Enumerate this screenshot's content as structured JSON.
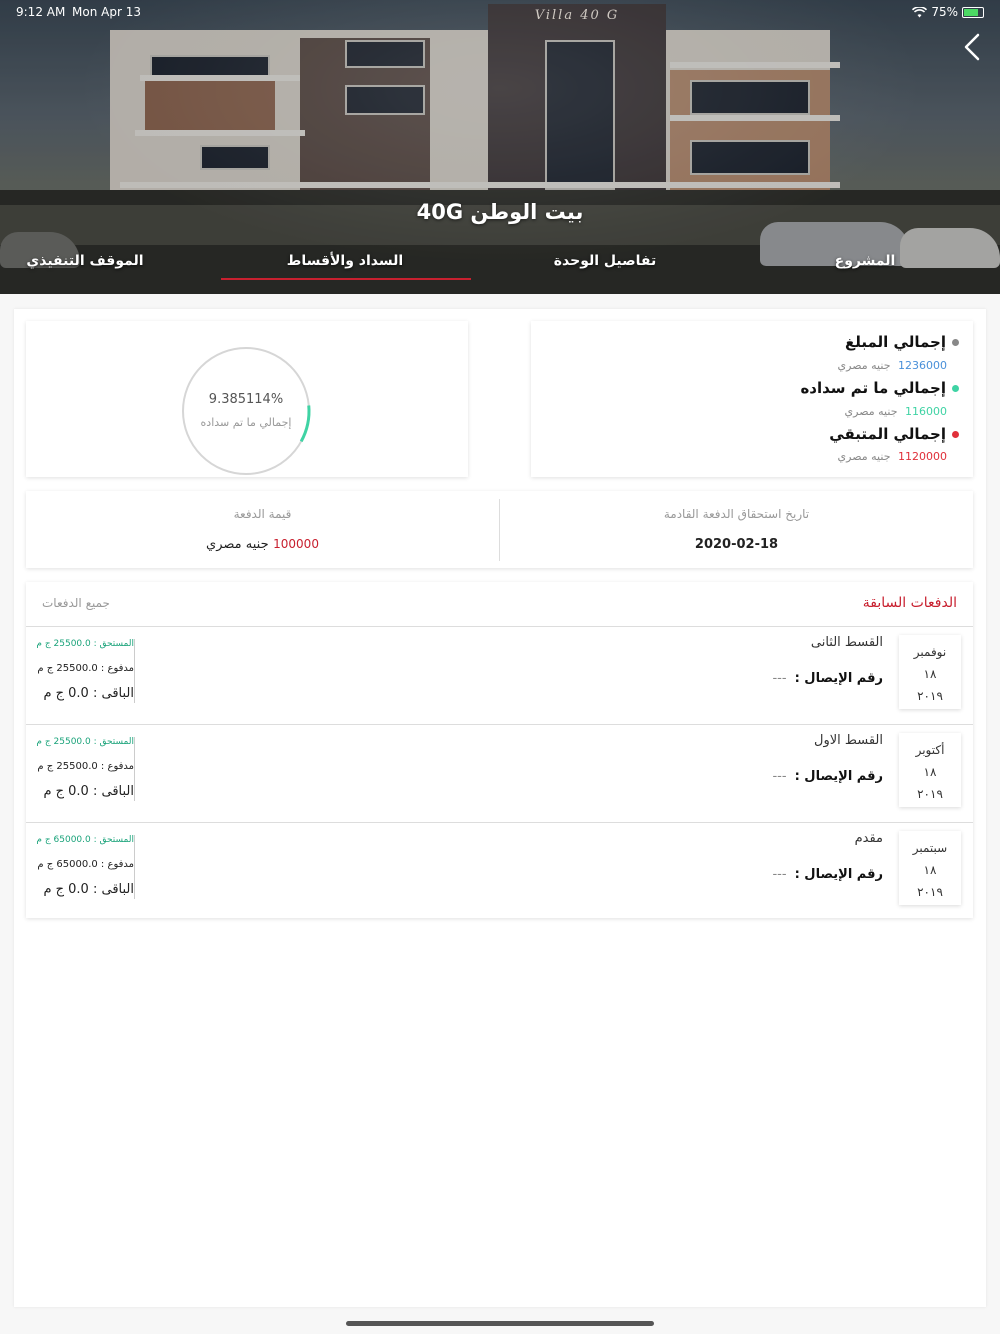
{
  "status_bar": {
    "time": "9:12 AM",
    "date": "Mon Apr 13",
    "battery": "75%"
  },
  "hero": {
    "title": "بيت الوطن 40G",
    "sign": "Villa 40 G"
  },
  "tabs": [
    {
      "label": "المشروع"
    },
    {
      "label": "تفاصيل الوحدة"
    },
    {
      "label": "السداد والأقساط"
    },
    {
      "label": "الموقف التنفيذي"
    }
  ],
  "summary": {
    "total_label": "إجمالي المبلغ",
    "total_amount": "1236000",
    "paid_label": "إجمالي ما تم سداده",
    "paid_amount": "116000",
    "remaining_label": "إجمالي المتبقي",
    "remaining_amount": "1120000",
    "currency": "جنيه مصري",
    "colors": {
      "total": "#4a90d9",
      "paid": "#3fd3a4",
      "remaining": "#e0303a"
    }
  },
  "progress": {
    "percent_text": "9.385114%",
    "label": "إجمالي ما تم سداده",
    "fraction": 0.0939
  },
  "next_payment": {
    "due_date_label": "تاريخ استحقاق الدفعة القادمة",
    "due_date": "2020-02-18",
    "amount_label": "قيمة الدفعة",
    "amount": "100000",
    "currency": "جنيه مصري"
  },
  "payments": {
    "title": "الدفعات السابقة",
    "all_link": "جميع الدفعات",
    "receipt_label": "رقم الإيصال :",
    "rows": [
      {
        "month": "نوفمبر",
        "day": "١٨",
        "year": "٢٠١٩",
        "name": "القسط الثانى",
        "receipt": "---",
        "due": "المستحق : 25500.0 ج م",
        "paid": "مدفوع : 25500.0 ج م",
        "remaining": "الباقى : 0.0 ج م"
      },
      {
        "month": "أكتوبر",
        "day": "١٨",
        "year": "٢٠١٩",
        "name": "القسط الاول",
        "receipt": "---",
        "due": "المستحق : 25500.0 ج م",
        "paid": "مدفوع : 25500.0 ج م",
        "remaining": "الباقى : 0.0 ج م"
      },
      {
        "month": "سبتمبر",
        "day": "١٨",
        "year": "٢٠١٩",
        "name": "مقدم",
        "receipt": "---",
        "due": "المستحق : 65000.0 ج م",
        "paid": "مدفوع : 65000.0 ج م",
        "remaining": "الباقى : 0.0 ج م"
      }
    ]
  },
  "colors": {
    "accent": "#c8202f",
    "success": "#1aa37a"
  }
}
